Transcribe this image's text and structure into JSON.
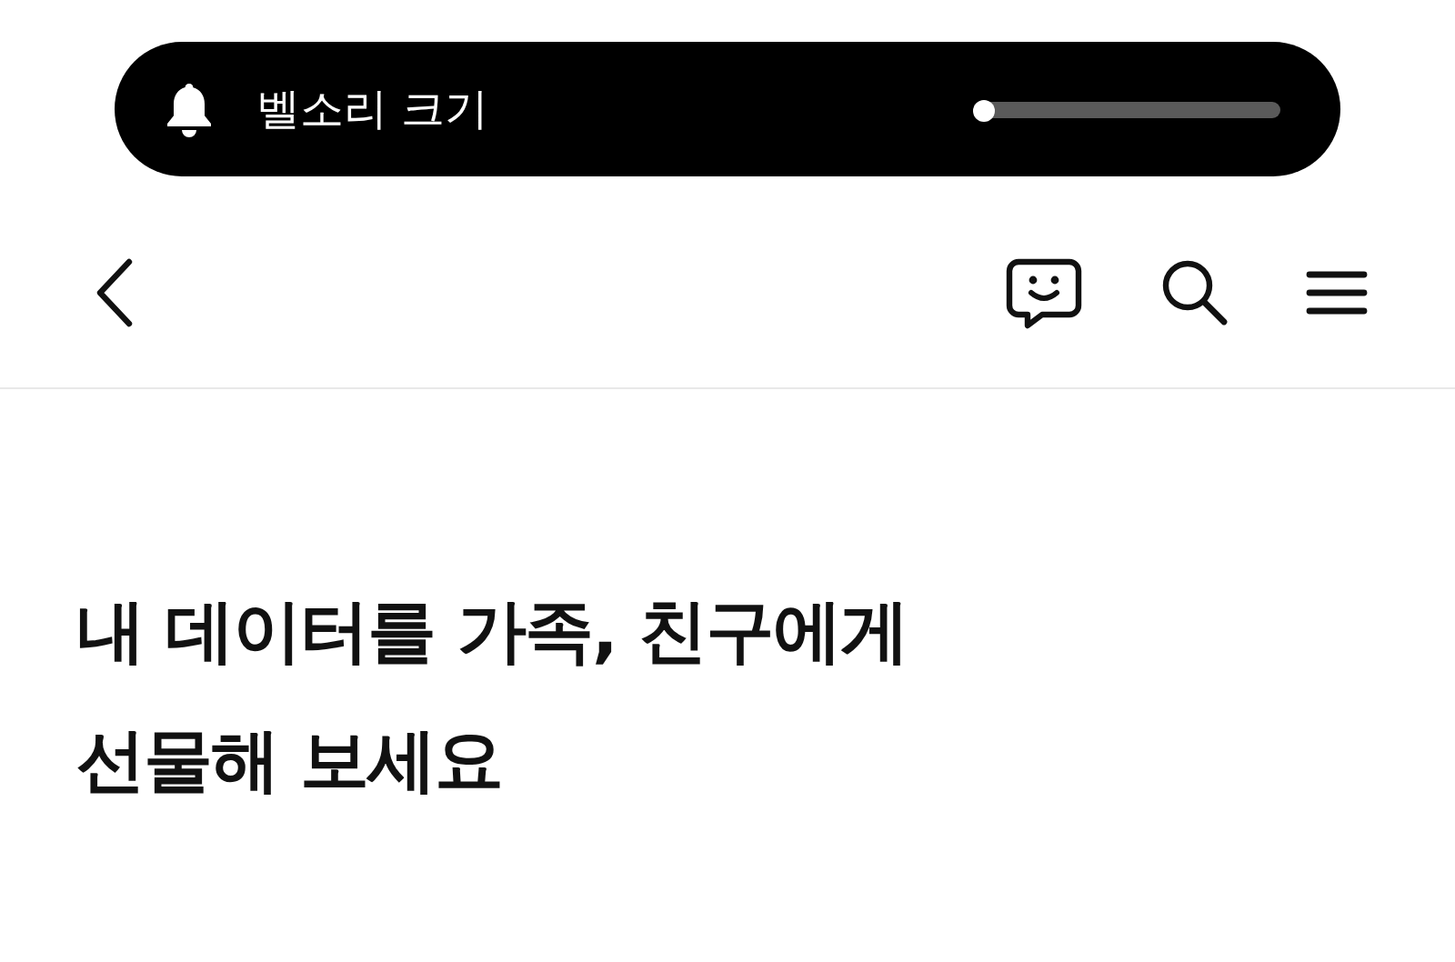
{
  "volume_toast": {
    "label": "벨소리 크기",
    "level": 0.02
  },
  "headline": [
    "내 데이터를 가족, 친구에게",
    "선물해 보세요"
  ]
}
